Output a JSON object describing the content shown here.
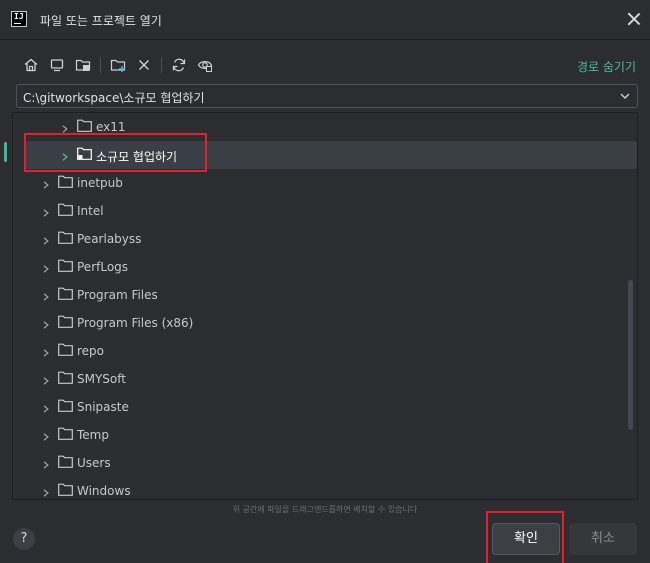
{
  "window": {
    "title": "파일 또는 프로젝트 열기"
  },
  "toolbar": {
    "hide_path_label": "경로 숨기기"
  },
  "path": {
    "value": "C:\\gitworkspace\\소규모 협업하기"
  },
  "tree": {
    "items": [
      {
        "label": "ex11",
        "level": 2
      },
      {
        "label": "소규모 협업하기",
        "level": 2,
        "selected": true
      },
      {
        "label": "inetpub",
        "level": 1
      },
      {
        "label": "Intel",
        "level": 1
      },
      {
        "label": "Pearlabyss",
        "level": 1
      },
      {
        "label": "PerfLogs",
        "level": 1
      },
      {
        "label": "Program Files",
        "level": 1
      },
      {
        "label": "Program Files (x86)",
        "level": 1
      },
      {
        "label": "repo",
        "level": 1
      },
      {
        "label": "SMYSoft",
        "level": 1
      },
      {
        "label": "Snipaste",
        "level": 1
      },
      {
        "label": "Temp",
        "level": 1
      },
      {
        "label": "Users",
        "level": 1
      },
      {
        "label": "Windows",
        "level": 1
      }
    ]
  },
  "footer": {
    "hint": "위 공간에 파일을 드래그앤드롭하면 배치할 수 있습니다",
    "help": "?",
    "ok_label": "확인",
    "cancel_label": "취소"
  },
  "colors": {
    "accent": "#4eb7a7",
    "background": "#2b2d30",
    "highlight_box": "#e0202e"
  }
}
